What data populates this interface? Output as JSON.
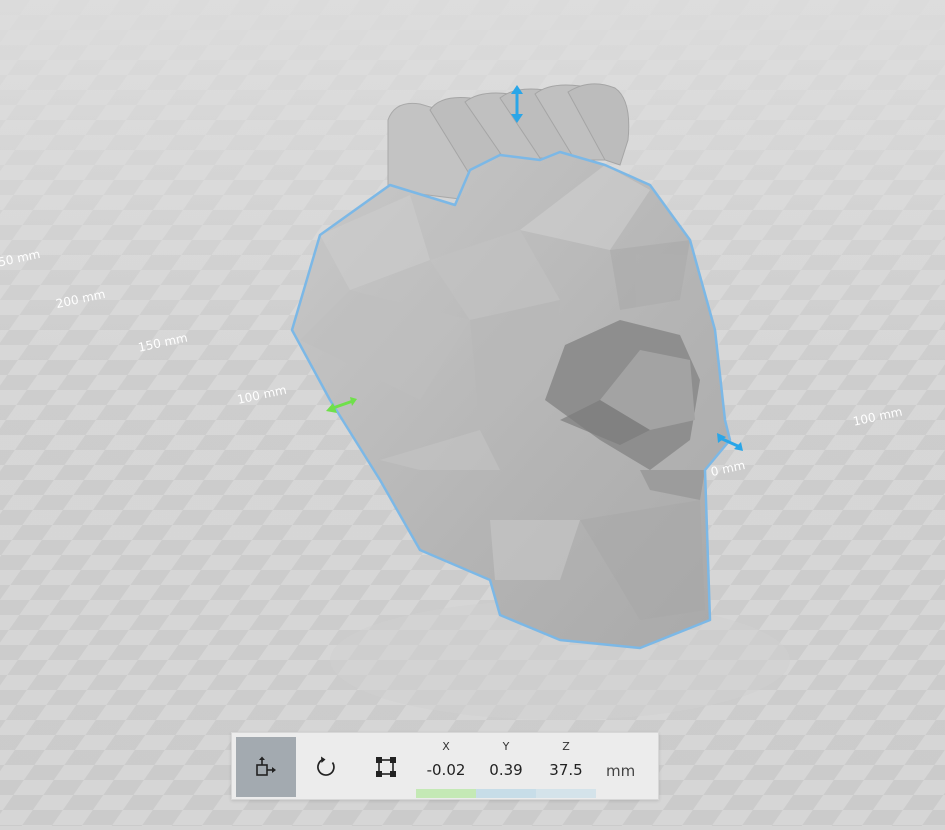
{
  "viewport": {
    "ruler_labels": [
      "50 mm",
      "200 mm",
      "150 mm",
      "100 mm",
      "100 mm",
      "0 mm"
    ],
    "colors": {
      "floor": "#d5d5d5",
      "floor_check": "#c9c9c9",
      "selection_outline": "#7cb8e6",
      "handle_blue": "#2aa6e8",
      "handle_green": "#6fe04a",
      "model": "#b8b8b8"
    }
  },
  "toolbar": {
    "tools": [
      {
        "name": "move-tool",
        "icon": "move-icon",
        "active": true
      },
      {
        "name": "rotate-tool",
        "icon": "rotate-icon",
        "active": false
      },
      {
        "name": "scale-tool",
        "icon": "scale-icon",
        "active": false
      }
    ],
    "coordinates": {
      "x": {
        "label": "X",
        "value": "-0.02",
        "color": "#c4e9b5"
      },
      "y": {
        "label": "Y",
        "value": "0.39",
        "color": "#c7dde8"
      },
      "z": {
        "label": "Z",
        "value": "37.5",
        "color": "#d4e3ea"
      }
    },
    "unit": "mm"
  }
}
